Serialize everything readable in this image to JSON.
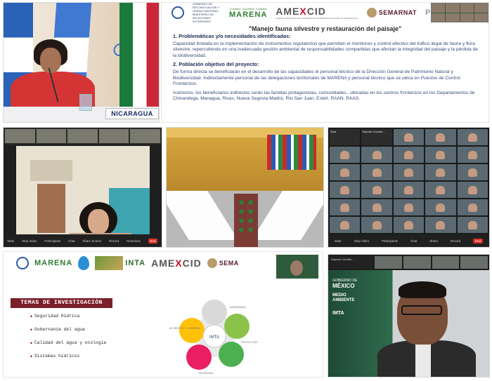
{
  "panel1": {
    "name_plate": "NICARAGUA"
  },
  "panel2": {
    "logos": {
      "gov_text": "GOBIERNO DE RECONCILIACIÓN Y UNIDAD NACIONAL",
      "gov_ministry": "MINISTERIO DE RELACIONES EXTERIORES",
      "marena_tag": "Cristiana, Socialista, Solidaria",
      "marena": "MARENA",
      "amexcid_a": "AME",
      "amexcid_x": "X",
      "amexcid_b": "CID",
      "amexcid_sub": "AGENCIA MEXICANA DE COOPERACIÓN INTERNACIONAL PARA EL DESARROLLO",
      "semarnat": "SEMARNAT",
      "pr": "PR"
    },
    "title": "\"Manejo fauna silvestre y restauración del paisaje\"",
    "section1_heading": "1.  Problemáticas y/o necesidades identificadas:",
    "section1_text": "Capacidad limitada en la implementación de instrumentos regulatorios que permiten el monitoreo y control efectivo del tráfico ilegal de fauna y flora silvestre, repercutiendo en una inadecuada gestión ambiental de responsabilidades compartidas que afectan la integridad del paisaje y la pérdida de la biodiversidad.",
    "section2_heading": "2.  Población objetivo del proyecto:",
    "section2_text1": "De forma directa se beneficiarán en el desarrollo de las capacidades el personal técnico de la Dirección General de Patrimonio Natural y Biodiversidad. Indirectamente personal de las delegaciones territoriales de MARENA y personal técnico que se ubica en Puestos de Control Fronterizos.",
    "section2_text2": "Asimismo, los beneficiarios indirectos serán las familias protagonistas, comunidades., ubicadas en los centros fronterizos en los Departamentos de Chinandega, Managua, Rivas, Nueva Segovia Madriz, Río San Juan, Estelí, RAAN. RAAS."
  },
  "panel3": {
    "controls": [
      "Mute",
      "Stop Video",
      "Participants",
      "Chat",
      "Share Screen",
      "Record",
      "Reactions",
      "End"
    ]
  },
  "panel5": {
    "tile_label": "Soporte Coordin...",
    "tile_label_short": "Sust",
    "controls": [
      "Mute",
      "Stop Video",
      "Participants",
      "Chat",
      "Share",
      "Record",
      "End"
    ]
  },
  "panel6": {
    "marena": "MARENA",
    "inta": "INTA",
    "amexcid_a": "AME",
    "amexcid_x": "X",
    "amexcid_b": "CID",
    "sema": "SEMA",
    "topics_header": "TEMAS DE INVESTIGACIÓN",
    "topics": [
      "Seguridad Hídrica",
      "Gobernanza del agua",
      "Calidad del agua y ecología",
      "Sistemas hídricos"
    ],
    "cycle_labels": [
      "ALIMENTOS Y ENERGÍA",
      "GOBERNANZA",
      "PROTECCIÓN",
      "SEGURIDAD"
    ],
    "cycle_center": "IMTA"
  },
  "panel7": {
    "tile_label": "Soporte Coordin...",
    "gob": "GOBIERNO DE",
    "country": "MÉXICO",
    "ministry_l1": "MEDIO",
    "ministry_l2": "AMBIENTE",
    "institute": "IMTA"
  },
  "colors": {
    "topics_header_bg": "#7b1f2b",
    "marena_green": "#2e7d32",
    "amexcid_red": "#c8102e",
    "slide_text": "#3a4a7a"
  }
}
